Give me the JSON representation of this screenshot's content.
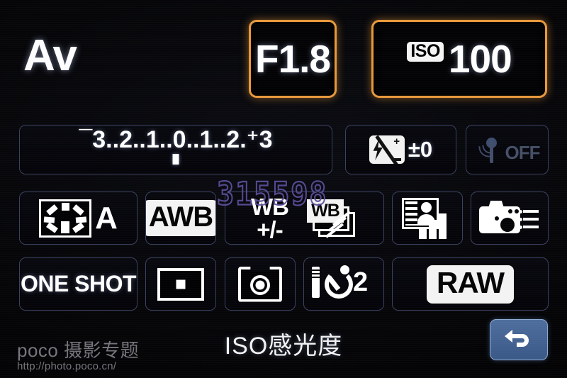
{
  "screen": {
    "device": "camera-quick-control-screen",
    "shooting_mode": "Av",
    "background_color": "#050507",
    "highlight_color": "#e8983c",
    "tile_border_color": "#3a4060"
  },
  "top_row": {
    "mode_label": "Av",
    "aperture": {
      "label": "F1.8",
      "selected": false
    },
    "iso": {
      "badge": "ISO",
      "value": "100",
      "selected": true
    }
  },
  "exposure": {
    "scale_text": "¯3..2..1..0..1..2.⁺3",
    "minus_sign": "¯",
    "plus_sign": "⁺",
    "ticks": [
      "3",
      "2",
      "1",
      "0",
      "1",
      "2",
      "3"
    ],
    "indicator_value": "0",
    "flash_compensation": {
      "icon": "flash-exposure-compensation-icon",
      "value": "±0"
    },
    "wifi": {
      "icon": "wifi-icon",
      "state": "OFF",
      "enabled": false
    }
  },
  "settings_grid": {
    "row2": [
      {
        "name": "picture-style",
        "icon": "picture-style-auto-icon",
        "letter": "A"
      },
      {
        "name": "white-balance",
        "label": "AWB",
        "style": "inverted"
      },
      {
        "name": "wb-shift-bracket",
        "shift_line1": "WB",
        "shift_line2": "+/-",
        "bracket_label": "WB"
      },
      {
        "name": "auto-lighting-optimizer",
        "icon": "auto-lighting-optimizer-icon"
      },
      {
        "name": "custom-controls",
        "icon": "custom-controls-camera-icon"
      }
    ],
    "row3": [
      {
        "name": "af-mode",
        "label": "ONE SHOT"
      },
      {
        "name": "af-area",
        "icon": "single-point-af-icon"
      },
      {
        "name": "metering-mode",
        "icon": "evaluative-metering-icon"
      },
      {
        "name": "drive-mode",
        "icon": "self-timer-icon",
        "value": "2"
      },
      {
        "name": "image-quality",
        "label": "RAW",
        "style": "inverted"
      }
    ]
  },
  "bottom_bar": {
    "help_text": "ISO感光度",
    "return_button": {
      "icon": "return-arrow-icon",
      "color": "#44639a"
    }
  },
  "watermarks": {
    "poco_brand": "poco 摄影专题",
    "poco_url": "http://photo.poco.cn/",
    "id_number": "315598"
  }
}
